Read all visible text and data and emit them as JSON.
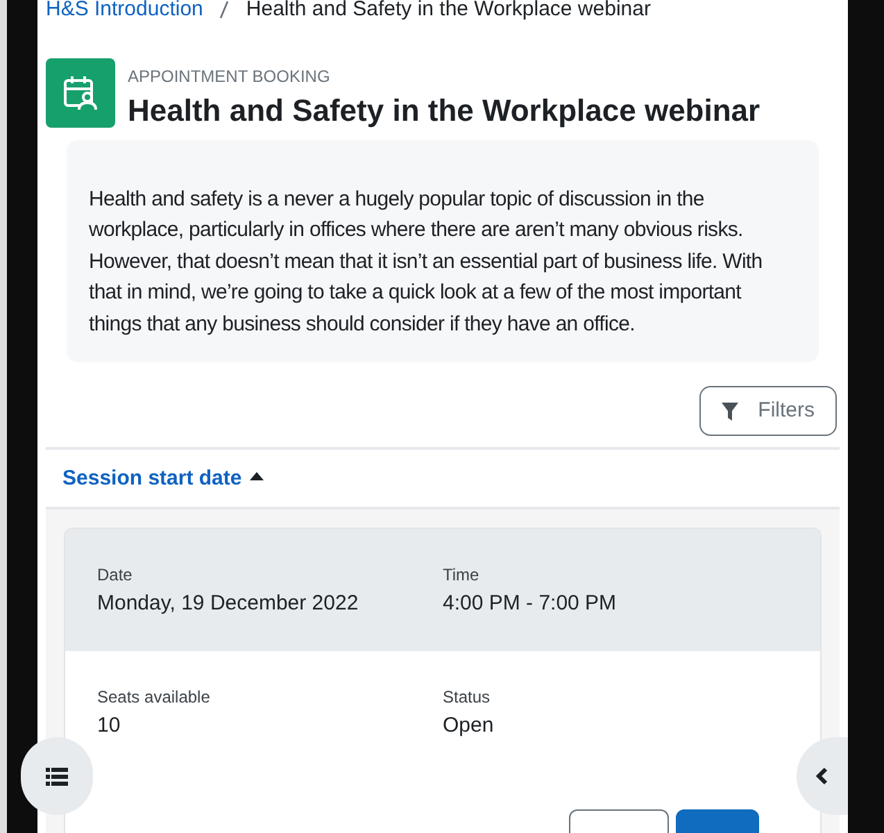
{
  "breadcrumb": [
    {
      "label": "H&S Introduction",
      "link": true
    },
    {
      "label": "Health and Safety in the Workplace webinar",
      "link": false
    }
  ],
  "header": {
    "subtitle": "APPOINTMENT BOOKING",
    "title": "Health and Safety in the Workplace webinar"
  },
  "description": "Health and safety is a never a hugely popular topic of discussion in the workplace, particularly in offices where there are aren’t many obvious risks. However, that doesn’t mean that it isn’t an essential part of business life. With that in mind, we’re going to take a quick look at a few of the most important things that any business should consider if they have an office.",
  "filters_button": "Filters",
  "sort_header": {
    "label": "Session start date",
    "ascending": true
  },
  "session": {
    "header_fields": [
      {
        "label": "Date",
        "value": "Monday, 19 December 2022"
      },
      {
        "label": "Time",
        "value": "4:00 PM - 7:00 PM"
      }
    ],
    "body_fields": [
      {
        "label": "Seats available",
        "value": "10"
      },
      {
        "label": "Status",
        "value": "Open"
      }
    ],
    "buttons": [
      {
        "kind": "secondary"
      },
      {
        "kind": "primary"
      }
    ]
  }
}
